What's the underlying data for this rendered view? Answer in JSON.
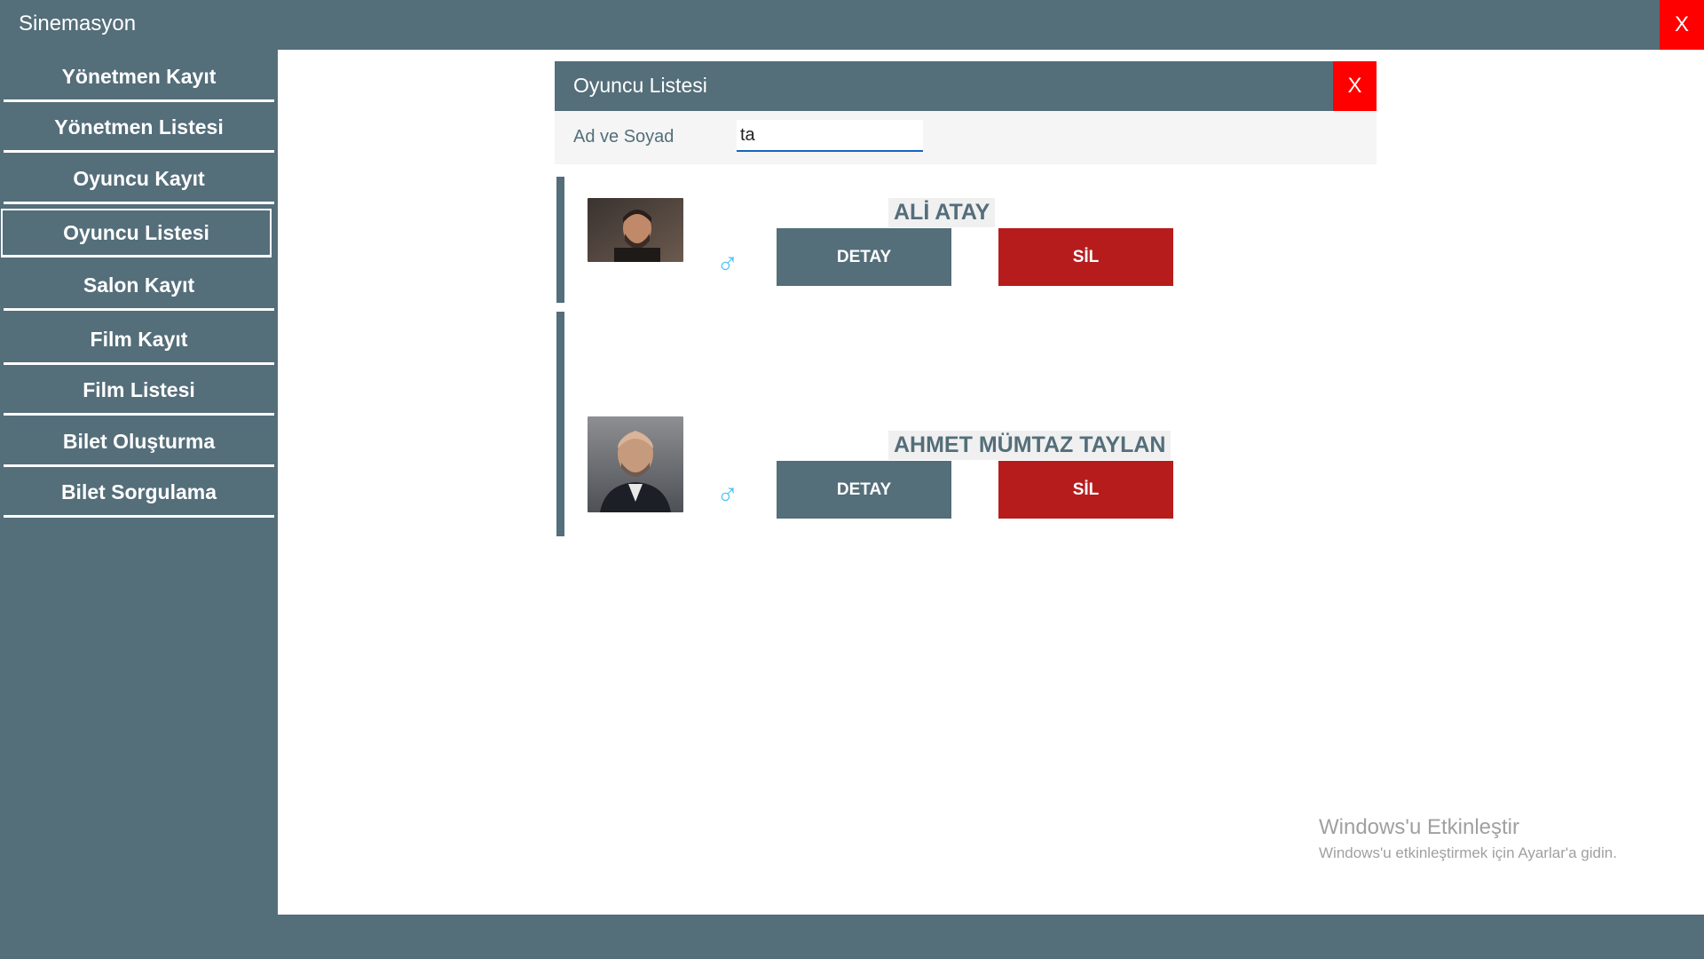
{
  "app": {
    "title": "Sinemasyon",
    "close_label": "X"
  },
  "sidebar": {
    "items": [
      {
        "label": "Yönetmen Kayıt"
      },
      {
        "label": "Yönetmen Listesi"
      },
      {
        "label": "Oyuncu Kayıt"
      },
      {
        "label": "Oyuncu Listesi",
        "active": true
      },
      {
        "label": "Salon Kayıt"
      },
      {
        "label": "Film Kayıt"
      },
      {
        "label": "Film Listesi"
      },
      {
        "label": "Bilet Oluşturma"
      },
      {
        "label": "Bilet Sorgulama"
      }
    ]
  },
  "panel": {
    "title": "Oyuncu Listesi",
    "close_label": "X",
    "search": {
      "label": "Ad ve Soyad",
      "value": "ta"
    },
    "actors": [
      {
        "name": "ALİ ATAY",
        "gender_icon": "male-icon",
        "detail_label": "DETAY",
        "delete_label": "SİL"
      },
      {
        "name": "AHMET MÜMTAZ  TAYLAN",
        "gender_icon": "male-icon",
        "detail_label": "DETAY",
        "delete_label": "SİL"
      }
    ]
  },
  "watermark": {
    "title": "Windows'u Etkinleştir",
    "subtitle": "Windows'u etkinleştirmek için Ayarlar'a gidin."
  },
  "colors": {
    "primary": "#546e7a",
    "close": "#ff0000",
    "delete": "#b71c1c",
    "gender": "#4fc3f7"
  }
}
